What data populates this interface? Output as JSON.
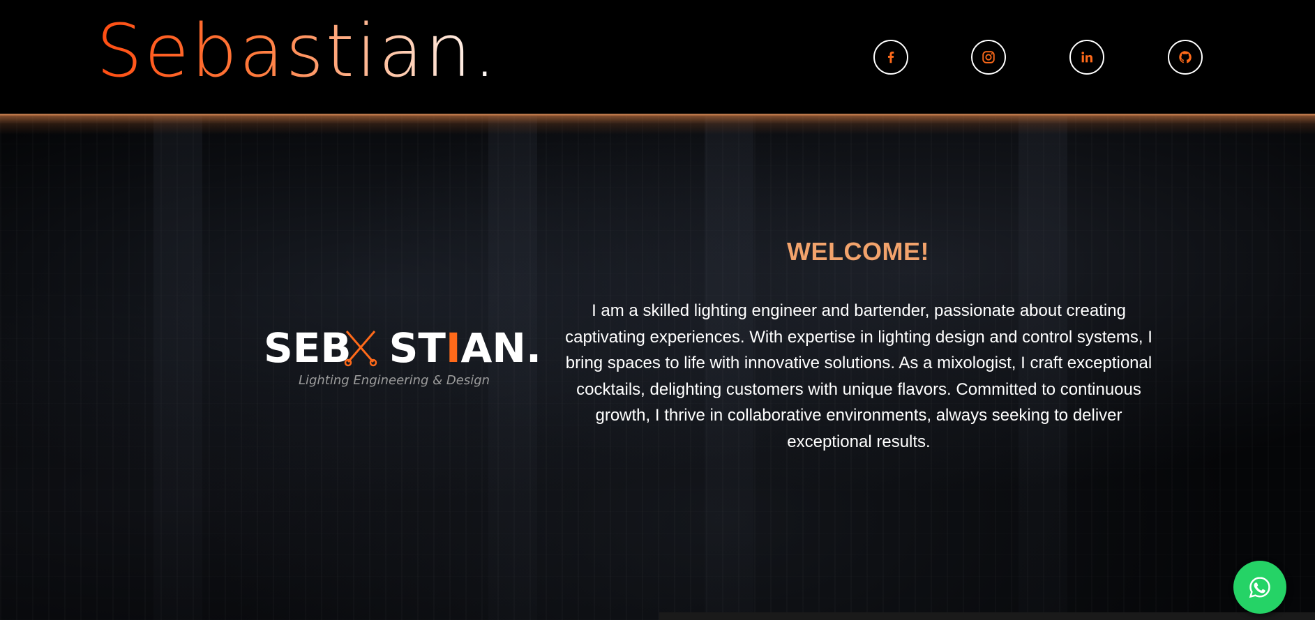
{
  "header": {
    "brand": "Sebastian.",
    "social_links": [
      {
        "name": "facebook",
        "icon": "facebook-icon"
      },
      {
        "name": "instagram",
        "icon": "instagram-icon"
      },
      {
        "name": "linkedin",
        "icon": "linkedin-icon"
      },
      {
        "name": "github",
        "icon": "github-icon"
      }
    ],
    "colors": {
      "accent": "#ff6a1a",
      "icon": "#ff6a1a",
      "glow": "#b9774b"
    }
  },
  "hero": {
    "logo": {
      "word_a": "SEB",
      "word_b": "ST",
      "word_c": "I",
      "word_d": "AN",
      "word_e": ".",
      "tagline": "Lighting Engineering & Design"
    },
    "welcome_title": "WELCOME!",
    "about_text": "I am a skilled lighting engineer and bartender, passionate about creating captivating experiences. With expertise in lighting design and control systems, I bring spaces to life with innovative solutions. As a mixologist, I craft exceptional cocktails, delighting customers with unique flavors. Committed to continuous growth, I thrive in collaborative environments, always seeking to deliver exceptional results.",
    "colors": {
      "welcome": "#f2a36c",
      "text": "#ffffff"
    }
  },
  "whatsapp": {
    "icon": "whatsapp-icon",
    "color": "#25d366"
  }
}
